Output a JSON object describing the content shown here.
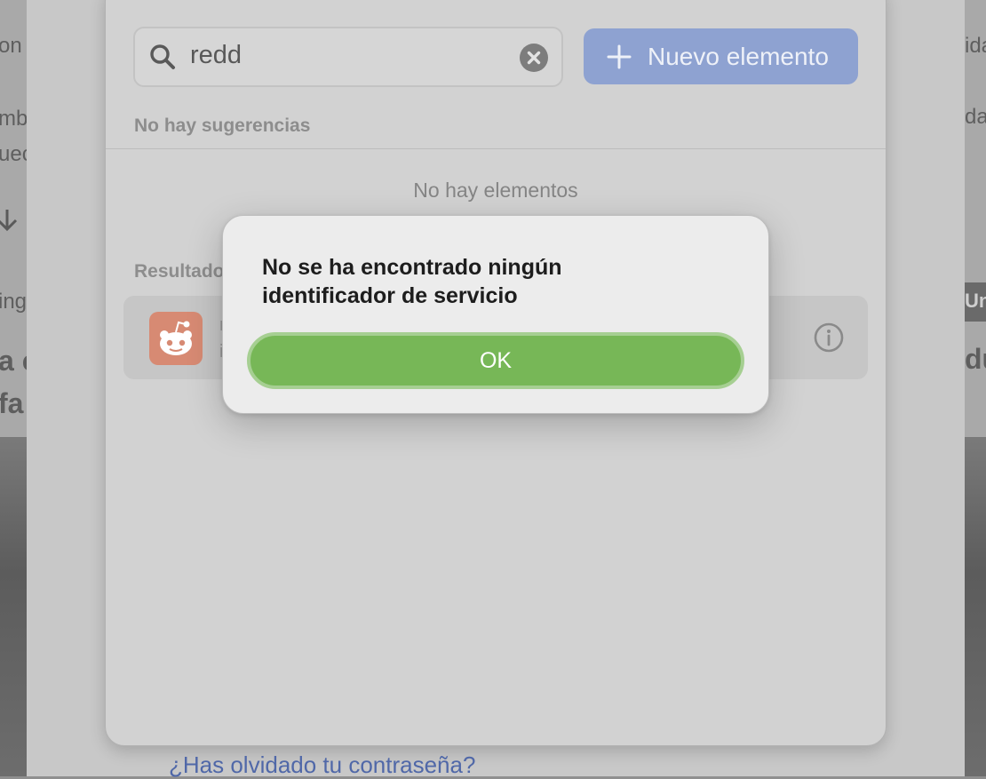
{
  "background": {
    "left_fragments": [
      "on",
      "mb",
      "uec",
      "ing",
      "a c",
      "fa"
    ],
    "right_fragments": [
      "ida",
      "da",
      "Uni",
      "du"
    ]
  },
  "search": {
    "value": "redd",
    "icon": "search-icon",
    "clear_icon": "clear-icon"
  },
  "new_item_button": {
    "label": "Nuevo elemento",
    "icon": "plus-icon",
    "color": "#8ea2d1"
  },
  "suggestions": {
    "header": "No hay sugerencias",
    "empty_text": "No hay elementos"
  },
  "results": {
    "header": "Resultado",
    "item": {
      "icon": "reddit-logo-icon",
      "title": "r",
      "subtitle": "i",
      "info_icon": "info-icon"
    }
  },
  "forgot_password": "¿Has olvidado tu contraseña?",
  "alert": {
    "message": "No se ha encontrado ningún identificador de servicio",
    "ok_label": "OK",
    "ok_color": "#77b757"
  }
}
